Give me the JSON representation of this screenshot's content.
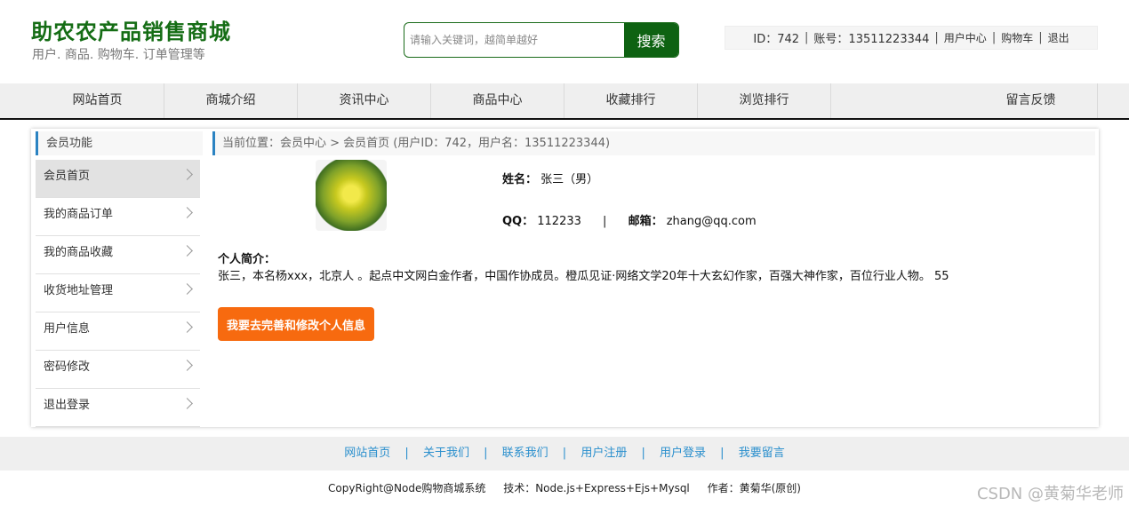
{
  "header": {
    "title": "助农农产品销售商城",
    "subtitle": "用户. 商品. 购物车. 订单管理等",
    "search_placeholder": "请输入关键词，越简单越好",
    "search_button": "搜索"
  },
  "user_bar": {
    "id_text": "ID：742",
    "account_text": "账号：13511223344",
    "user_center": "用户中心",
    "cart": "购物车",
    "logout": "退出",
    "separator": "|"
  },
  "nav": {
    "items": [
      "网站首页",
      "商城介绍",
      "资讯中心",
      "商品中心",
      "收藏排行",
      "浏览排行",
      "留言反馈"
    ]
  },
  "sidebar": {
    "title": "会员功能",
    "items": [
      {
        "label": "会员首页"
      },
      {
        "label": "我的商品订单"
      },
      {
        "label": "我的商品收藏"
      },
      {
        "label": "收货地址管理"
      },
      {
        "label": "用户信息"
      },
      {
        "label": "密码修改"
      },
      {
        "label": "退出登录"
      }
    ]
  },
  "breadcrumb": "当前位置：会员中心 > 会员首页 (用户ID：742，用户名：13511223344)",
  "profile": {
    "name_label": "姓名：",
    "name_value": "张三（男）",
    "qq_label": "QQ：",
    "qq_value": "112233",
    "separator": "|",
    "email_label": "邮箱：",
    "email_value": "zhang@qq.com",
    "bio_title": "个人简介：",
    "bio_text": "张三，本名杨xxx，北京人 。起点中文网白金作者，中国作协成员。橙瓜见证·网络文学20年十大玄幻作家，百强大神作家，百位行业人物。 55",
    "edit_button": "我要去完善和修改个人信息"
  },
  "footer": {
    "links": [
      "网站首页",
      "关于我们",
      "联系我们",
      "用户注册",
      "用户登录",
      "我要留言"
    ],
    "separator": "|",
    "copyright": "CopyRight@Node购物商城系统",
    "tech": "技术：Node.js+Express+Ejs+Mysql",
    "author": "作者：黄菊华(原创)"
  },
  "watermark": "CSDN @黄菊华老师",
  "colors": {
    "brand_green": "#156d15",
    "search_green": "#0e6212",
    "accent_blue": "#2b83c2",
    "button_orange": "#f76a0f",
    "link_blue": "#2a8fcd"
  }
}
